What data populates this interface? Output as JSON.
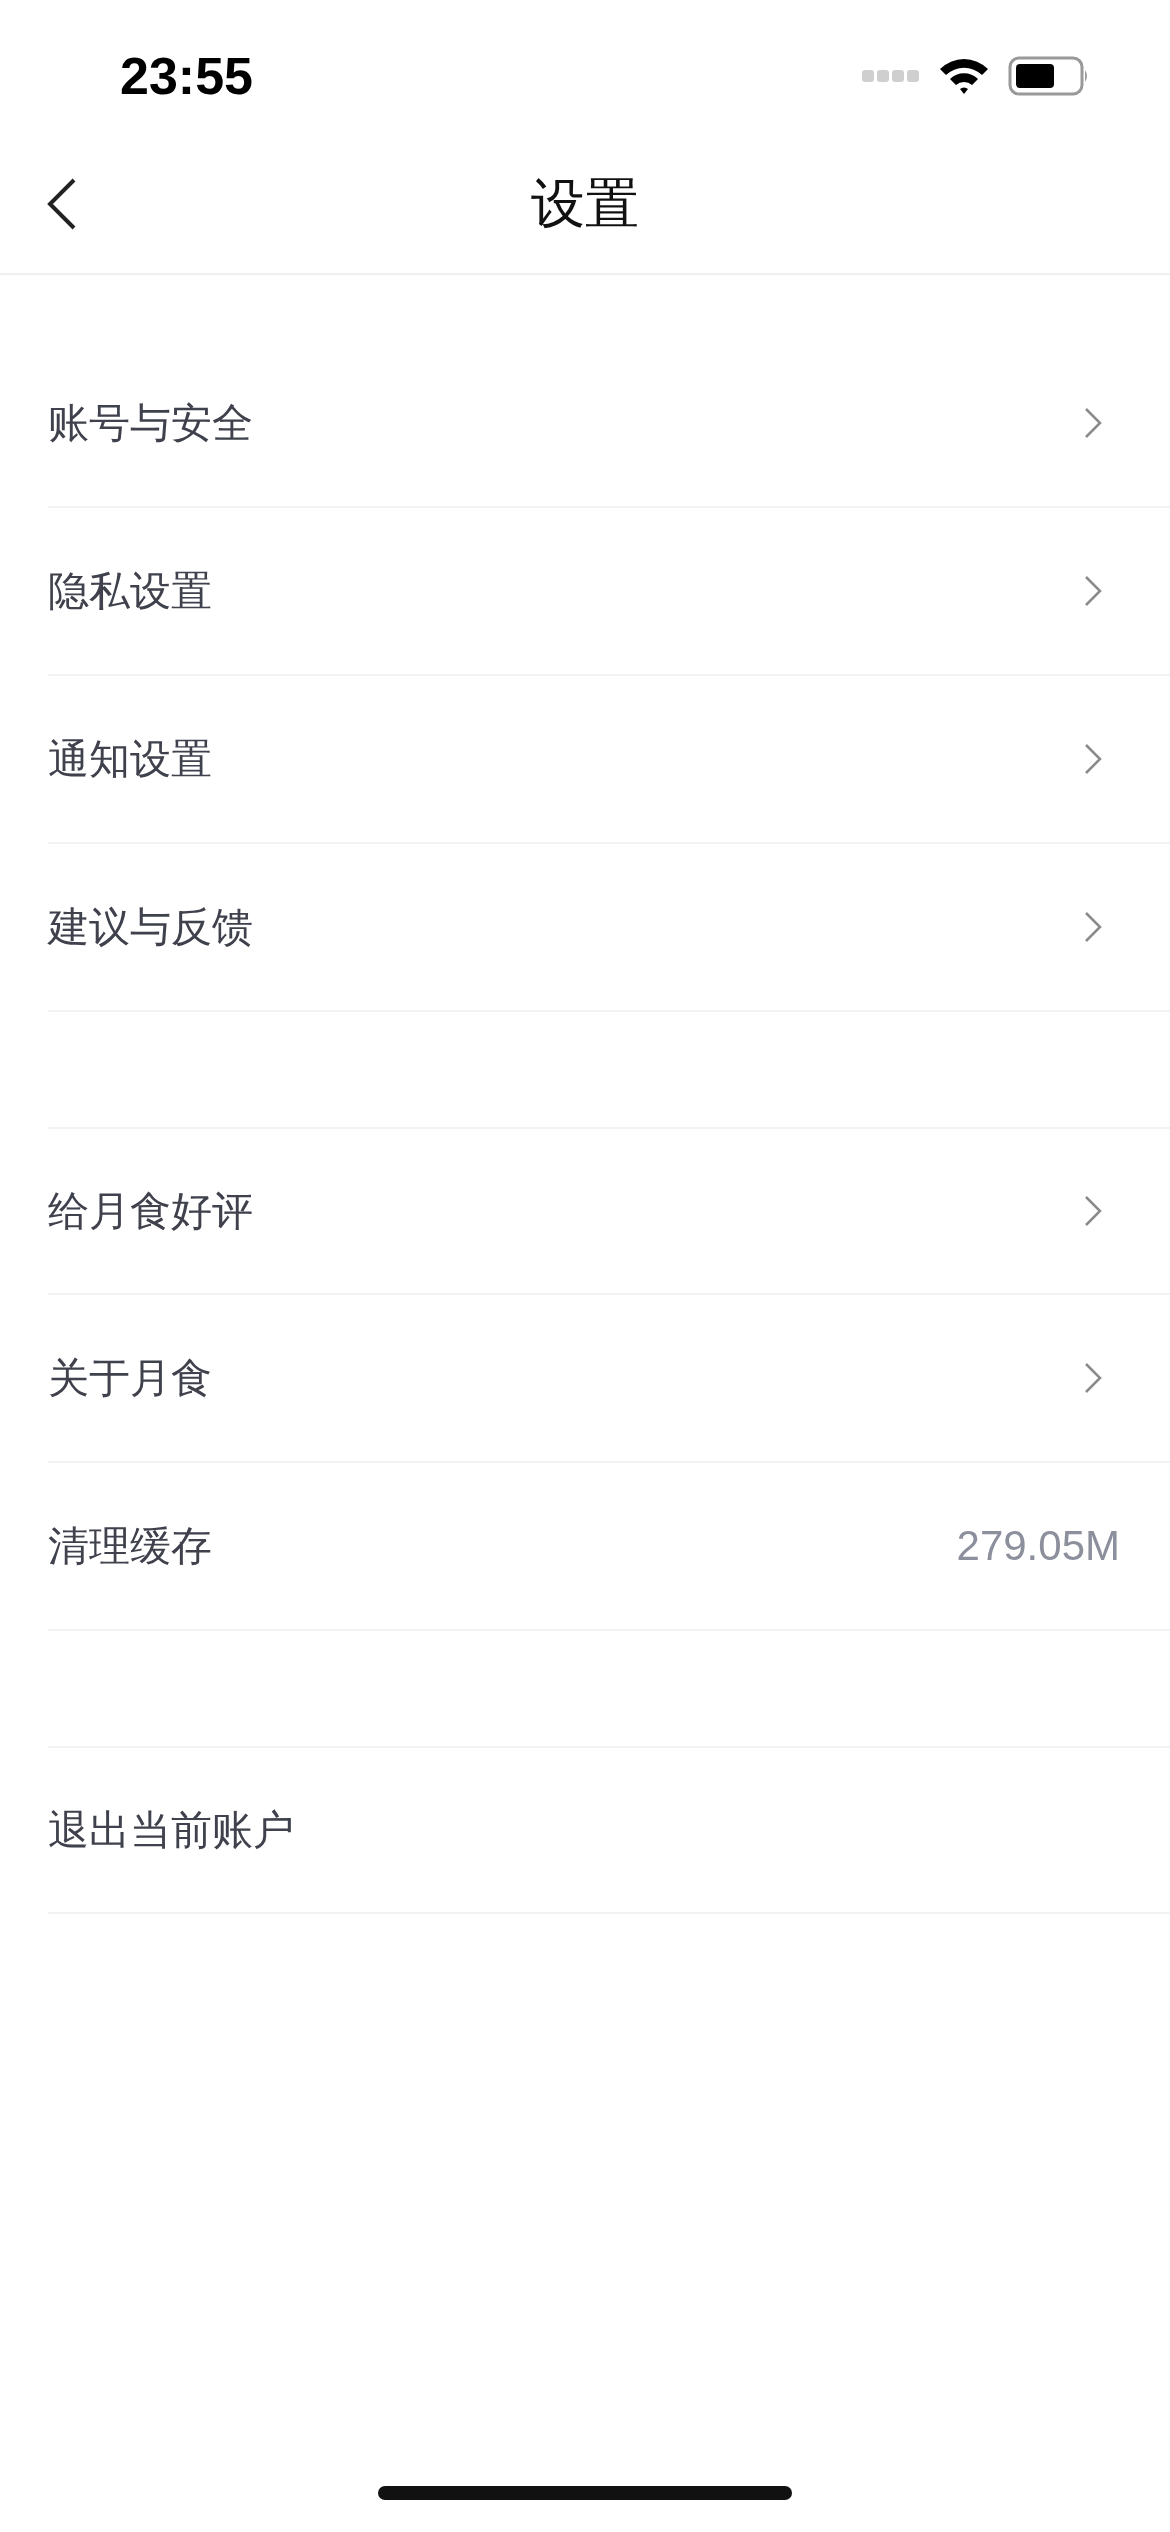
{
  "status_bar": {
    "time": "23:55"
  },
  "nav": {
    "title": "设置"
  },
  "sections": [
    {
      "items": [
        {
          "label": "账号与安全",
          "kind": "link"
        },
        {
          "label": "隐私设置",
          "kind": "link"
        },
        {
          "label": "通知设置",
          "kind": "link"
        },
        {
          "label": "建议与反馈",
          "kind": "link"
        }
      ]
    },
    {
      "items": [
        {
          "label": "给月食好评",
          "kind": "link"
        },
        {
          "label": "关于月食",
          "kind": "link"
        },
        {
          "label": "清理缓存",
          "kind": "value",
          "value": "279.05M"
        }
      ]
    },
    {
      "items": [
        {
          "label": "退出当前账户",
          "kind": "action"
        }
      ]
    }
  ]
}
